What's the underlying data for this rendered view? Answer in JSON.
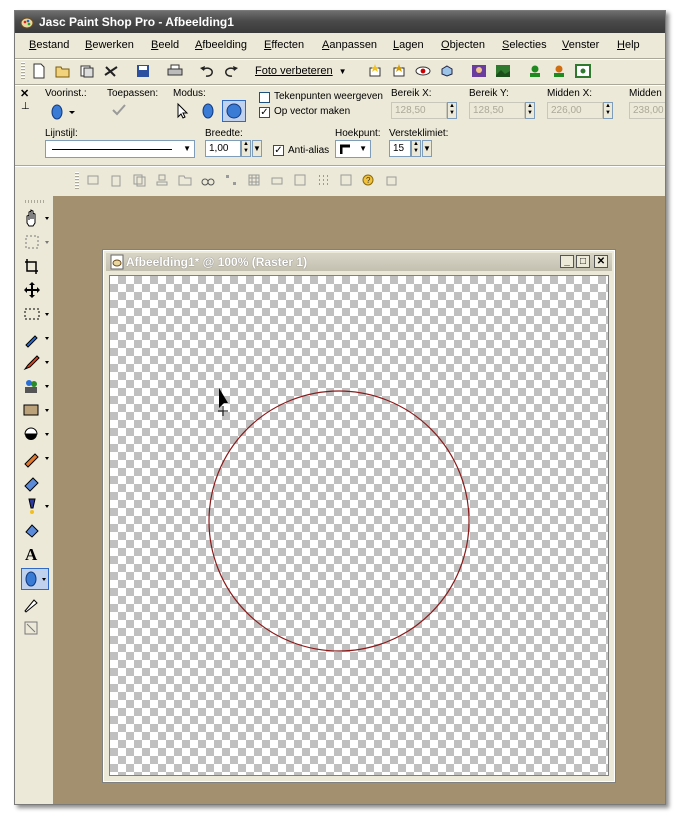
{
  "window": {
    "title": "Jasc Paint Shop Pro - Afbeelding1"
  },
  "menu": [
    "Bestand",
    "Bewerken",
    "Beeld",
    "Afbeelding",
    "Effecten",
    "Aanpassen",
    "Lagen",
    "Objecten",
    "Selecties",
    "Venster",
    "Help"
  ],
  "toolbar": {
    "enhance_label": "Foto verbeteren"
  },
  "options": {
    "preset_label": "Voorinst.:",
    "apply_label": "Toepassen:",
    "mode_label": "Modus:",
    "show_nodes_label": "Tekenpunten weergeven",
    "show_nodes_checked": false,
    "create_vector_label": "Op vector maken",
    "create_vector_checked": true,
    "range_x_label": "Bereik X:",
    "range_x_value": "128,50",
    "range_y_label": "Bereik Y:",
    "range_y_value": "128,50",
    "center_x_label": "Midden X:",
    "center_x_value": "226,00",
    "center_y_label": "Midden",
    "center_y_value": "238,00",
    "line_style_label": "Lijnstijl:",
    "width_label": "Breedte:",
    "width_value": "1,00",
    "antialias_label": "Anti-alias",
    "antialias_checked": true,
    "join_label": "Hoekpunt:",
    "miter_label": "Versteklimiet:",
    "miter_value": "15"
  },
  "image_window": {
    "title": "Afbeelding1* @ 100% (Raster 1)"
  },
  "colors": {
    "circle_stroke": "#8b1a1a",
    "workspace": "#a3906f",
    "selected_tool_bg": "#c1d2ee"
  }
}
